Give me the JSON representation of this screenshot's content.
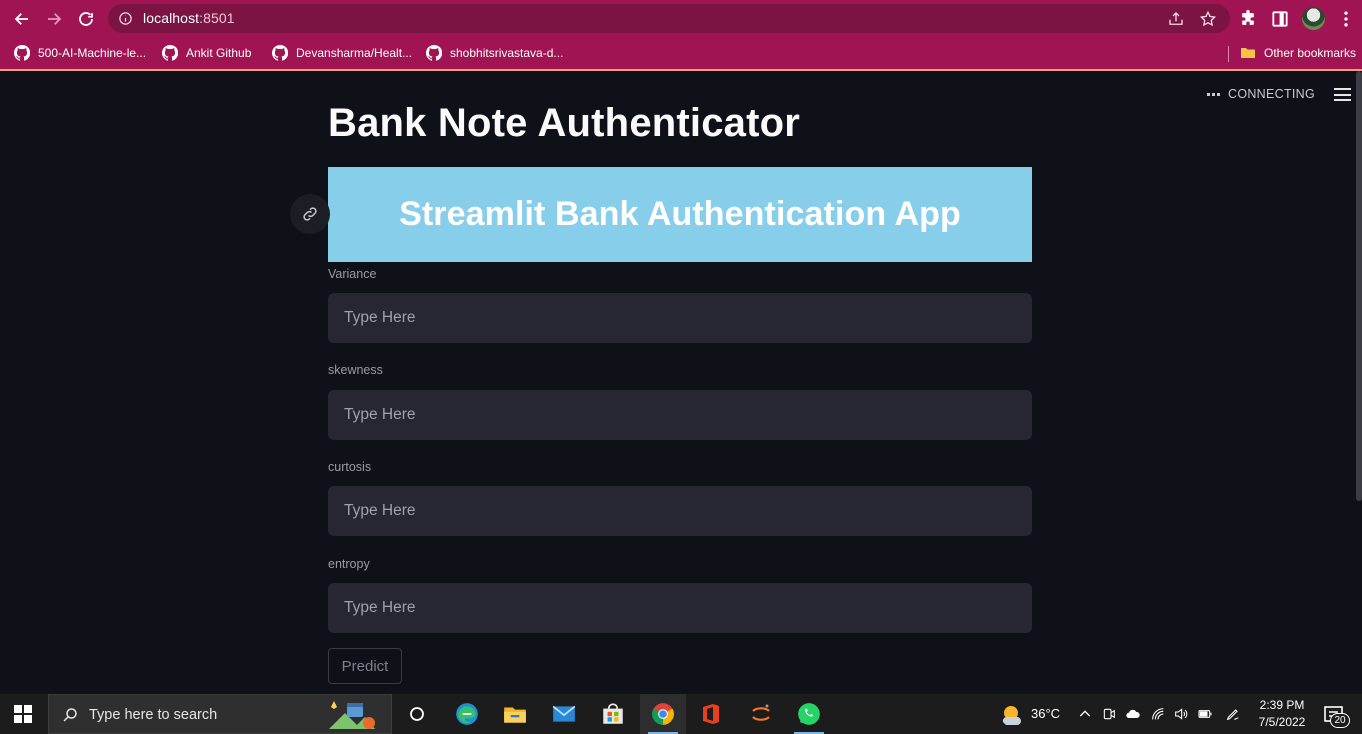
{
  "browser": {
    "url_host": "localhost",
    "url_port": ":8501",
    "bookmarks": [
      {
        "label": "500-AI-Machine-le...",
        "icon": "github-icon"
      },
      {
        "label": "Ankit Github",
        "icon": "github-icon"
      },
      {
        "label": "Devansharma/Healt...",
        "icon": "github-icon"
      },
      {
        "label": "shobhitsrivastava-d...",
        "icon": "github-icon"
      }
    ],
    "other_bookmarks": "Other bookmarks"
  },
  "app": {
    "status": "CONNECTING",
    "title": "Bank Note Authenticator",
    "banner": "Streamlit Bank Authentication App",
    "banner_color": "#87ceeb",
    "fields": [
      {
        "label": "Variance",
        "placeholder": "Type Here",
        "value": ""
      },
      {
        "label": "skewness",
        "placeholder": "Type Here",
        "value": ""
      },
      {
        "label": "curtosis",
        "placeholder": "Type Here",
        "value": ""
      },
      {
        "label": "entropy",
        "placeholder": "Type Here",
        "value": ""
      }
    ],
    "predict_label": "Predict"
  },
  "taskbar": {
    "search_placeholder": "Type here to search",
    "weather": "36°C",
    "time": "2:39 PM",
    "date": "7/5/2022",
    "notifications": "20",
    "apps": [
      "cortana-icon",
      "edge-icon",
      "file-explorer-icon",
      "mail-icon",
      "store-icon",
      "chrome-icon",
      "office-icon",
      "jupyter-icon",
      "whatsapp-icon"
    ]
  },
  "colors": {
    "chrome_frame": "#a01454",
    "page_bg": "#0e1117",
    "input_bg": "#262730"
  }
}
